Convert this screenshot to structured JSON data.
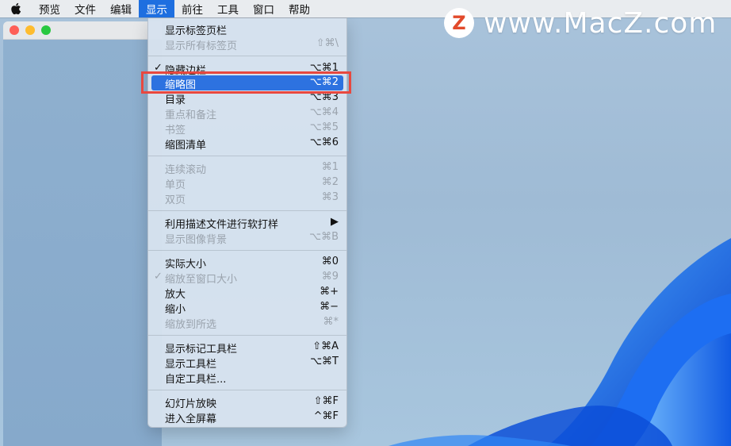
{
  "menubar": {
    "apple_icon": "apple-logo-icon",
    "items": [
      "预览",
      "文件",
      "编辑",
      "显示",
      "前往",
      "工具",
      "窗口",
      "帮助"
    ],
    "active_index": 3
  },
  "watermark": {
    "logo_letter": "Z",
    "text": "www.MacZ.com"
  },
  "view_menu": {
    "items": [
      {
        "label": "显示标签页栏",
        "shortcut": "",
        "disabled": false,
        "checked": false
      },
      {
        "label": "显示所有标签页",
        "shortcut": "⇧⌘\\",
        "disabled": true,
        "checked": false
      },
      {
        "label": "隐藏边栏",
        "shortcut": "⌥⌘1",
        "disabled": false,
        "checked": true
      },
      {
        "label": "缩略图",
        "shortcut": "⌥⌘2",
        "disabled": false,
        "checked": false,
        "highlighted": true
      },
      {
        "label": "目录",
        "shortcut": "⌥⌘3",
        "disabled": false,
        "checked": false
      },
      {
        "label": "重点和备注",
        "shortcut": "⌥⌘4",
        "disabled": true,
        "checked": false
      },
      {
        "label": "书签",
        "shortcut": "⌥⌘5",
        "disabled": true,
        "checked": false
      },
      {
        "label": "缩图清单",
        "shortcut": "⌥⌘6",
        "disabled": false,
        "checked": false
      },
      {
        "label": "连续滚动",
        "shortcut": "⌘1",
        "disabled": true,
        "checked": false
      },
      {
        "label": "单页",
        "shortcut": "⌘2",
        "disabled": true,
        "checked": false
      },
      {
        "label": "双页",
        "shortcut": "⌘3",
        "disabled": true,
        "checked": false
      },
      {
        "label": "利用描述文件进行软打样",
        "shortcut": "▶",
        "disabled": false,
        "checked": false
      },
      {
        "label": "显示图像背景",
        "shortcut": "⌥⌘B",
        "disabled": true,
        "checked": false
      },
      {
        "label": "实际大小",
        "shortcut": "⌘0",
        "disabled": false,
        "checked": false
      },
      {
        "label": "缩放至窗口大小",
        "shortcut": "⌘9",
        "disabled": true,
        "checked": true
      },
      {
        "label": "放大",
        "shortcut": "⌘+",
        "disabled": false,
        "checked": false
      },
      {
        "label": "缩小",
        "shortcut": "⌘−",
        "disabled": false,
        "checked": false
      },
      {
        "label": "缩放到所选",
        "shortcut": "⌘*",
        "disabled": true,
        "checked": false
      },
      {
        "label": "显示标记工具栏",
        "shortcut": "⇧⌘A",
        "disabled": false,
        "checked": false
      },
      {
        "label": "显示工具栏",
        "shortcut": "⌥⌘T",
        "disabled": false,
        "checked": false
      },
      {
        "label": "自定工具栏...",
        "shortcut": "",
        "disabled": false,
        "checked": false
      },
      {
        "label": "幻灯片放映",
        "shortcut": "⇧⌘F",
        "disabled": false,
        "checked": false
      },
      {
        "label": "进入全屏幕",
        "shortcut": "^⌘F",
        "disabled": false,
        "checked": false
      }
    ],
    "check_glyph": "✓"
  },
  "colors": {
    "menu_highlight": "#2d72e0",
    "annotation_box": "#e8483f",
    "close": "#fe5f57",
    "minimize": "#febc2e",
    "zoom": "#28c840"
  }
}
